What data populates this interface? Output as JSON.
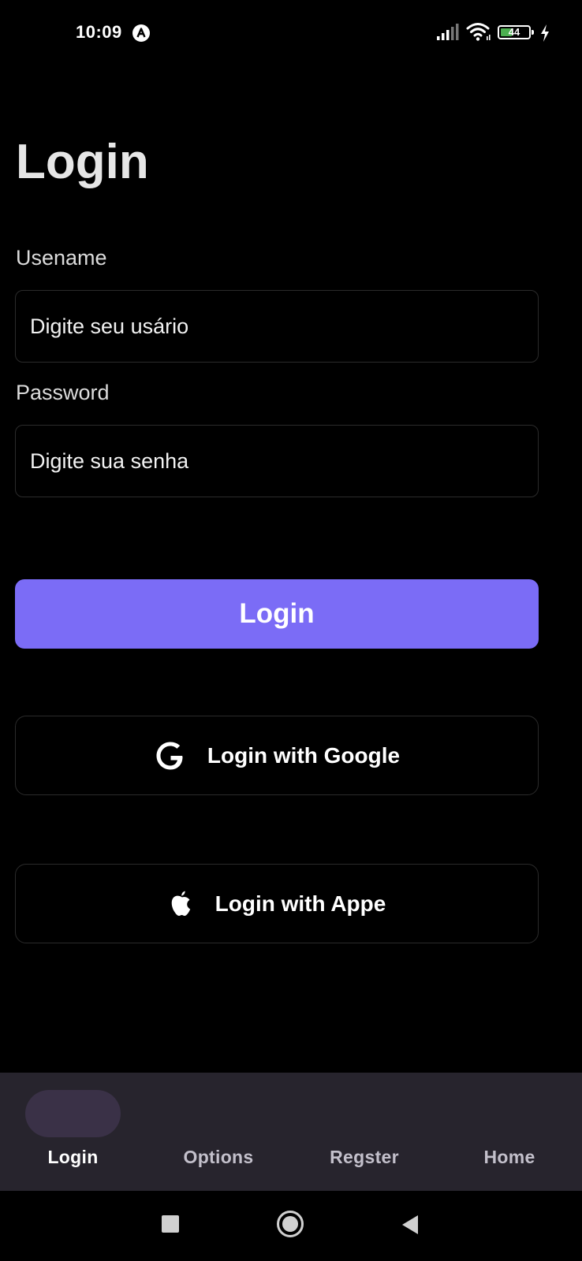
{
  "status_bar": {
    "time": "10:09",
    "notification_icon": "app-notification-icon",
    "battery_level": "44",
    "battery_color": "#4caf50"
  },
  "page": {
    "title": "Login"
  },
  "form": {
    "username_label": "Usename",
    "username_placeholder": "Digite seu usário",
    "password_label": "Password",
    "password_placeholder": "Digite sua senha",
    "login_button": "Login",
    "google_button": "Login with Google",
    "apple_button": "Login with Appe"
  },
  "bottom_nav": {
    "items": [
      {
        "label": "Login",
        "active": true
      },
      {
        "label": "Options",
        "active": false
      },
      {
        "label": "Regster",
        "active": false
      },
      {
        "label": "Home",
        "active": false
      }
    ]
  },
  "colors": {
    "accent": "#7b6cf6",
    "nav_background": "#27242d",
    "active_pill": "#3a3147"
  }
}
